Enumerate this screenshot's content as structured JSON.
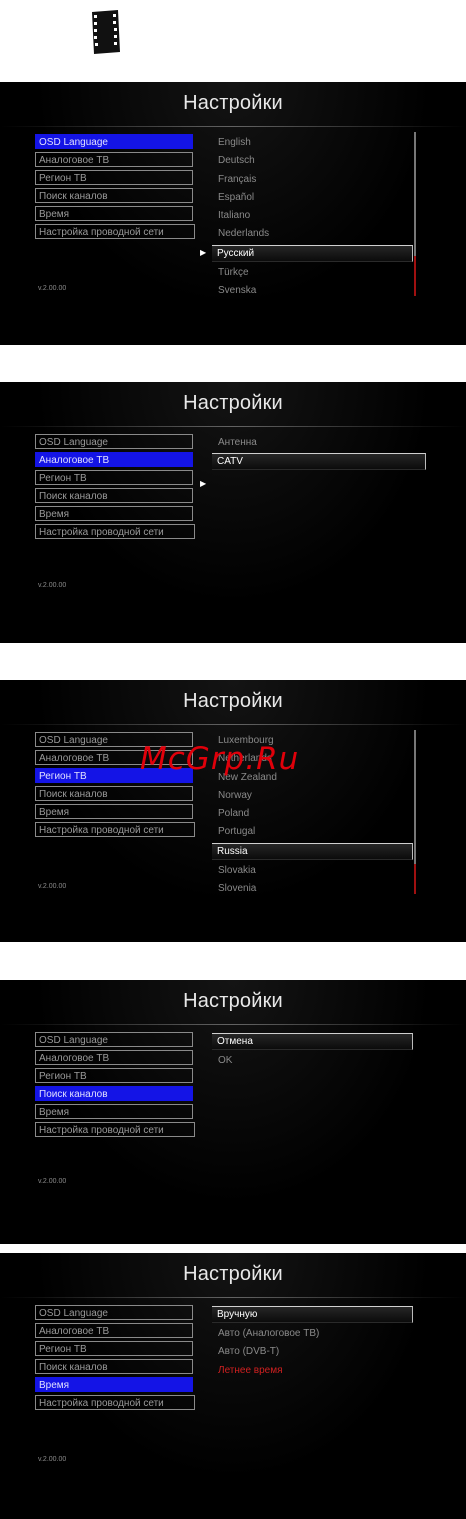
{
  "icon": "film-strip-icon",
  "title": "Настройки",
  "version": "v.2.00.00",
  "menu_items": [
    "OSD Language",
    "Аналоговое ТВ",
    "Регион ТВ",
    "Поиск каналов",
    "Время",
    "Настройка проводной сети"
  ],
  "panels": [
    {
      "selected_menu": "OSD Language",
      "options": [
        "English",
        "Deutsch",
        "Français",
        "Español",
        "Italiano",
        "Nederlands",
        "Русский",
        "Türkçe",
        "Svenska"
      ],
      "selected_option": "Русский"
    },
    {
      "selected_menu": "Аналоговое ТВ",
      "options": [
        "Антенна",
        "CATV"
      ],
      "selected_option": "CATV"
    },
    {
      "selected_menu": "Регион ТВ",
      "options": [
        "Luxembourg",
        "Netherlands",
        "New Zealand",
        "Norway",
        "Poland",
        "Portugal",
        "Russia",
        "Slovakia",
        "Slovenia"
      ],
      "selected_option": "Russia"
    },
    {
      "selected_menu": "Поиск каналов",
      "options": [
        "Отмена",
        "OK"
      ],
      "selected_option": "Отмена"
    },
    {
      "selected_menu": "Время",
      "options": [
        "Вручную",
        "Авто (Аналоговое ТВ)",
        "Авто (DVB-T)",
        "Летнее время"
      ],
      "selected_option": "Вручную",
      "highlight_option": "Летнее время"
    }
  ],
  "watermark": "McGrp.Ru",
  "colors": {
    "selection": "#1414e6",
    "panel_bg": "#000000",
    "accent_red": "#d02020"
  }
}
